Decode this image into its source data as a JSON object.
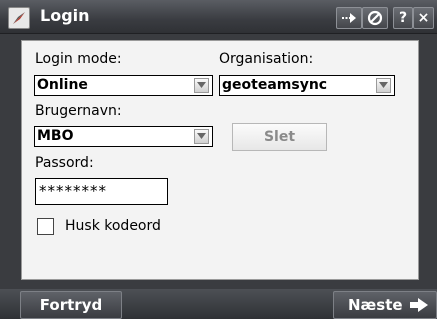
{
  "window": {
    "title": "Login"
  },
  "titlebar_buttons": {
    "help": "?",
    "close": "×"
  },
  "form": {
    "login_mode_label": "Login mode:",
    "login_mode_value": "Online",
    "organisation_label": "Organisation:",
    "organisation_value": "geoteamsync",
    "username_label": "Brugernavn:",
    "username_value": "MBO",
    "delete_button": "Slet",
    "password_label": "Passord:",
    "password_value": "********",
    "remember_label": "Husk kodeord",
    "remember_checked": false
  },
  "softkeys": {
    "cancel": "Fortryd",
    "next": "Næste"
  },
  "icons": {
    "app": "compass-icon",
    "sync": "sync-icon",
    "no_signal": "no-signal-icon",
    "dropdown": "chevron-down-icon",
    "next": "arrow-right-icon"
  }
}
